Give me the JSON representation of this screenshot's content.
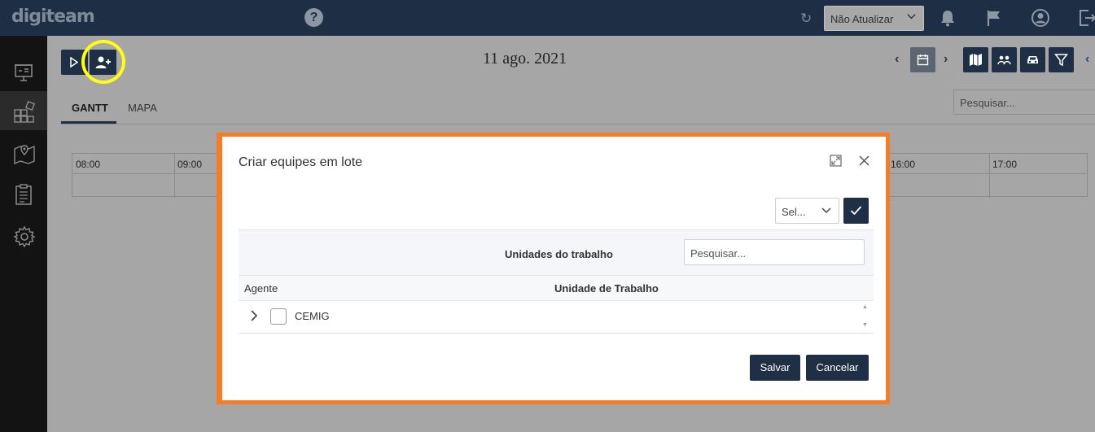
{
  "app": {
    "logo": "digiteam"
  },
  "header": {
    "update_select": {
      "value": "Não Atualizar"
    },
    "icons": [
      "help-icon",
      "refresh-icon",
      "bell-icon",
      "flag-icon",
      "user-icon",
      "logout-icon"
    ]
  },
  "sidebar": {
    "items": [
      {
        "name": "dashboard",
        "icon": "presentation-board-icon"
      },
      {
        "name": "teams",
        "icon": "grid-shapes-icon",
        "active": true
      },
      {
        "name": "map",
        "icon": "map-pin-icon"
      },
      {
        "name": "reports",
        "icon": "clipboard-icon"
      },
      {
        "name": "settings",
        "icon": "gear-icon"
      }
    ]
  },
  "toolbar": {
    "date": "11 ago. 2021",
    "prev": "‹",
    "next": "›",
    "collapse": "‹"
  },
  "tabs": [
    {
      "label": "GANTT",
      "active": true
    },
    {
      "label": "MAPA",
      "active": false
    }
  ],
  "search": {
    "placeholder": "Pesquisar..."
  },
  "gantt": {
    "hours_left": [
      "08:00",
      "09:00"
    ],
    "hours_right": [
      "16:00",
      "17:00"
    ]
  },
  "modal": {
    "title": "Criar equipes em lote",
    "select_value": "Sel...",
    "filter_label": "Unidades do trabalho",
    "filter_placeholder": "Pesquisar...",
    "columns": {
      "agent": "Agente",
      "unit": "Unidade de Trabalho"
    },
    "rows": [
      {
        "label": "CEMIG",
        "checked": false
      }
    ],
    "save_label": "Salvar",
    "cancel_label": "Cancelar"
  },
  "colors": {
    "navy": "#1f2f45",
    "highlight": "#ffff0f",
    "modal_border": "#f47d28"
  }
}
